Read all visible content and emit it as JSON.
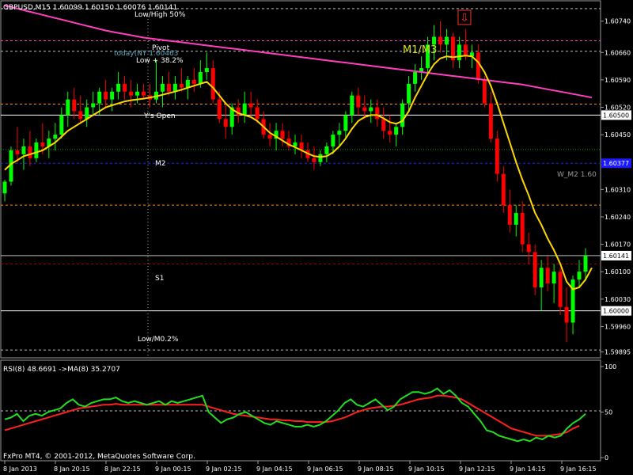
{
  "header": {
    "symbol_info": "GBPUSD,M15  1.60099 1.60150 1.60076 1.60141",
    "down_arrow_icon": "down-arrow-icon"
  },
  "annotations": {
    "lowhigh50": "Low/High 50%",
    "pivot": "Pivot",
    "today": "today(NY 1.60463",
    "low382": "Low + 38.2%",
    "m1m3": "M1/M3",
    "ys_open": "Y's Open",
    "m2": "M2",
    "wm2": "W_M2 1.60",
    "s1": "S1",
    "lowm0": "Low/M0.2%"
  },
  "price_axis": {
    "ticks": [
      "1.60740",
      "1.60660",
      "1.60590",
      "1.60520",
      "1.60450",
      "1.60310",
      "1.60240",
      "1.60170",
      "1.60100",
      "1.60030",
      "1.59960",
      "1.59895"
    ],
    "boxes": [
      "1.60500",
      "1.60377",
      "1.60141",
      "1.60000"
    ]
  },
  "time_axis": {
    "labels": [
      "8 Jan 2013",
      "8 Jan 20:15",
      "8 Jan 22:15",
      "9 Jan 00:15",
      "9 Jan 02:15",
      "9 Jan 04:15",
      "9 Jan 06:15",
      "9 Jan 08:15",
      "9 Jan 10:15",
      "9 Jan 12:15",
      "9 Jan 14:15",
      "9 Jan 16:15"
    ]
  },
  "rsi_panel": {
    "label": "RSI(8) 48.6691  ->MA(8) 35.2707",
    "ticks": [
      "100",
      "50",
      "0"
    ],
    "copyright": "FxPro MT4, © 2001-2012, MetaQuotes Software Corp."
  },
  "colors": {
    "bull": "#00ff00",
    "bear": "#ff0000",
    "ma": "#ffd700",
    "ma_long": "#ff3fbf",
    "rsi": "#22dd22",
    "rsi_ma": "#ff2020"
  },
  "chart_data": {
    "type": "line",
    "title": "GBPUSD,M15",
    "ylim": [
      1.5988,
      1.6079
    ],
    "candles": [
      [
        1.603,
        1.60335,
        1.6028,
        1.6033
      ],
      [
        1.6033,
        1.6042,
        1.6032,
        1.6041
      ],
      [
        1.6041,
        1.6047,
        1.6038,
        1.604
      ],
      [
        1.604,
        1.6044,
        1.6036,
        1.6042
      ],
      [
        1.6042,
        1.6046,
        1.6037,
        1.6039
      ],
      [
        1.6039,
        1.6044,
        1.6038,
        1.6043
      ],
      [
        1.6043,
        1.6048,
        1.604,
        1.6042
      ],
      [
        1.6042,
        1.6046,
        1.6039,
        1.6044
      ],
      [
        1.6044,
        1.6048,
        1.6041,
        1.6045
      ],
      [
        1.6045,
        1.6052,
        1.6044,
        1.605
      ],
      [
        1.605,
        1.6056,
        1.6047,
        1.6054
      ],
      [
        1.6054,
        1.6057,
        1.6049,
        1.6051
      ],
      [
        1.6051,
        1.6055,
        1.6048,
        1.6049
      ],
      [
        1.6049,
        1.6054,
        1.6047,
        1.6052
      ],
      [
        1.6052,
        1.6056,
        1.605,
        1.6053
      ],
      [
        1.6053,
        1.6057,
        1.605,
        1.6056
      ],
      [
        1.6056,
        1.6059,
        1.6052,
        1.6054
      ],
      [
        1.6054,
        1.6057,
        1.6051,
        1.6056
      ],
      [
        1.6056,
        1.6061,
        1.6054,
        1.6058
      ],
      [
        1.6058,
        1.606,
        1.6054,
        1.6056
      ],
      [
        1.6056,
        1.6059,
        1.6052,
        1.6055
      ],
      [
        1.6055,
        1.6058,
        1.6053,
        1.6056
      ],
      [
        1.6056,
        1.6058,
        1.6054,
        1.6055
      ],
      [
        1.6055,
        1.6058,
        1.6052,
        1.6054
      ],
      [
        1.6054,
        1.6064,
        1.6053,
        1.6056
      ],
      [
        1.6056,
        1.606,
        1.6052,
        1.6058
      ],
      [
        1.6058,
        1.6061,
        1.6055,
        1.6056
      ],
      [
        1.6056,
        1.606,
        1.6054,
        1.6058
      ],
      [
        1.6058,
        1.6062,
        1.6056,
        1.6057
      ],
      [
        1.6057,
        1.606,
        1.6054,
        1.6059
      ],
      [
        1.6059,
        1.6062,
        1.6056,
        1.6058
      ],
      [
        1.6058,
        1.6064,
        1.6057,
        1.6061
      ],
      [
        1.6061,
        1.6066,
        1.6059,
        1.6062
      ],
      [
        1.6062,
        1.6064,
        1.6053,
        1.6054
      ],
      [
        1.6054,
        1.6056,
        1.6048,
        1.6049
      ],
      [
        1.6049,
        1.6053,
        1.6044,
        1.6047
      ],
      [
        1.6047,
        1.6053,
        1.6045,
        1.6052
      ],
      [
        1.6052,
        1.6054,
        1.6048,
        1.605
      ],
      [
        1.605,
        1.6056,
        1.6048,
        1.6053
      ],
      [
        1.6053,
        1.6056,
        1.605,
        1.6052
      ],
      [
        1.6052,
        1.6054,
        1.6048,
        1.6049
      ],
      [
        1.6049,
        1.6051,
        1.6044,
        1.6045
      ],
      [
        1.6045,
        1.6048,
        1.6042,
        1.6044
      ],
      [
        1.6044,
        1.6048,
        1.6041,
        1.6046
      ],
      [
        1.6046,
        1.6048,
        1.6042,
        1.6044
      ],
      [
        1.6044,
        1.6046,
        1.6041,
        1.6042
      ],
      [
        1.6042,
        1.6045,
        1.604,
        1.6043
      ],
      [
        1.6043,
        1.6045,
        1.6039,
        1.6041
      ],
      [
        1.6041,
        1.6043,
        1.6038,
        1.6039
      ],
      [
        1.6039,
        1.6042,
        1.6036,
        1.6038
      ],
      [
        1.6038,
        1.6041,
        1.6037,
        1.604
      ],
      [
        1.604,
        1.6043,
        1.6038,
        1.6042
      ],
      [
        1.6042,
        1.6046,
        1.604,
        1.6045
      ],
      [
        1.6045,
        1.6048,
        1.6042,
        1.6046
      ],
      [
        1.6046,
        1.6051,
        1.6044,
        1.605
      ],
      [
        1.605,
        1.6056,
        1.6048,
        1.6055
      ],
      [
        1.6055,
        1.6057,
        1.605,
        1.6052
      ],
      [
        1.6052,
        1.6055,
        1.6049,
        1.6051
      ],
      [
        1.6051,
        1.6054,
        1.6048,
        1.6052
      ],
      [
        1.6052,
        1.6054,
        1.6047,
        1.6049
      ],
      [
        1.6049,
        1.6052,
        1.6044,
        1.6046
      ],
      [
        1.6046,
        1.605,
        1.6043,
        1.6045
      ],
      [
        1.6045,
        1.6048,
        1.6042,
        1.6047
      ],
      [
        1.6047,
        1.6054,
        1.6045,
        1.6053
      ],
      [
        1.6053,
        1.606,
        1.6051,
        1.6058
      ],
      [
        1.6058,
        1.6063,
        1.6056,
        1.6061
      ],
      [
        1.6061,
        1.6065,
        1.6059,
        1.6062
      ],
      [
        1.6062,
        1.607,
        1.606,
        1.6068
      ],
      [
        1.6068,
        1.6073,
        1.6064,
        1.607
      ],
      [
        1.607,
        1.6074,
        1.6066,
        1.6068
      ],
      [
        1.6068,
        1.6072,
        1.6064,
        1.607
      ],
      [
        1.607,
        1.6071,
        1.6062,
        1.6064
      ],
      [
        1.6064,
        1.607,
        1.6062,
        1.6068
      ],
      [
        1.6068,
        1.6072,
        1.6064,
        1.6065
      ],
      [
        1.6065,
        1.6068,
        1.6062,
        1.6066
      ],
      [
        1.6066,
        1.6068,
        1.6058,
        1.6059
      ],
      [
        1.6059,
        1.606,
        1.6052,
        1.6053
      ],
      [
        1.6053,
        1.6056,
        1.6043,
        1.6044
      ],
      [
        1.6044,
        1.6046,
        1.6033,
        1.6035
      ],
      [
        1.6035,
        1.6037,
        1.6025,
        1.6027
      ],
      [
        1.6027,
        1.6031,
        1.602,
        1.6022
      ],
      [
        1.6022,
        1.6027,
        1.6019,
        1.6025
      ],
      [
        1.6025,
        1.6028,
        1.6015,
        1.6017
      ],
      [
        1.6017,
        1.602,
        1.6012,
        1.6015
      ],
      [
        1.6015,
        1.6017,
        1.6004,
        1.6006
      ],
      [
        1.6006,
        1.6013,
        1.6,
        1.6011
      ],
      [
        1.6011,
        1.6014,
        1.6005,
        1.6007
      ],
      [
        1.6007,
        1.6012,
        1.6002,
        1.601
      ],
      [
        1.601,
        1.6011,
        1.5999,
        1.6001
      ],
      [
        1.6001,
        1.6006,
        1.5992,
        1.5997
      ],
      [
        1.5997,
        1.6009,
        1.5994,
        1.6008
      ],
      [
        1.6008,
        1.6013,
        1.6006,
        1.601
      ],
      [
        1.601,
        1.6016,
        1.60076,
        1.60141
      ]
    ],
    "ma_short": [
      1.6036,
      1.60375,
      1.60385,
      1.60395,
      1.604,
      1.60405,
      1.6041,
      1.6042,
      1.6043,
      1.60445,
      1.6046,
      1.6047,
      1.6048,
      1.6049,
      1.605,
      1.6051,
      1.6052,
      1.60525,
      1.6053,
      1.60535,
      1.60538,
      1.6054,
      1.60542,
      1.60545,
      1.60548,
      1.60552,
      1.60556,
      1.6056,
      1.60565,
      1.6057,
      1.60575,
      1.6058,
      1.60585,
      1.6057,
      1.6055,
      1.6053,
      1.60515,
      1.60505,
      1.605,
      1.60495,
      1.60485,
      1.6047,
      1.60455,
      1.60445,
      1.60435,
      1.60425,
      1.60418,
      1.6041,
      1.60402,
      1.60395,
      1.60393,
      1.60395,
      1.60405,
      1.6042,
      1.6044,
      1.60465,
      1.60485,
      1.60495,
      1.605,
      1.605,
      1.60492,
      1.60482,
      1.60478,
      1.60485,
      1.6051,
      1.60545,
      1.60575,
      1.60605,
      1.6063,
      1.60645,
      1.6065,
      1.60648,
      1.6065,
      1.60652,
      1.6065,
      1.60635,
      1.6061,
      1.60575,
      1.6053,
      1.6048,
      1.6043,
      1.6038,
      1.60335,
      1.60295,
      1.6025,
      1.6022,
      1.60185,
      1.60155,
      1.6012,
      1.60075,
      1.60055,
      1.6006,
      1.6008,
      1.6011
    ],
    "ma_long": [
      1.6078,
      1.60776,
      1.60772,
      1.60768,
      1.60764,
      1.6076,
      1.60756,
      1.60752,
      1.60748,
      1.60744,
      1.6074,
      1.60736,
      1.60732,
      1.60728,
      1.60724,
      1.6072,
      1.60716,
      1.60713,
      1.6071,
      1.60707,
      1.60704,
      1.60701,
      1.60698,
      1.60696,
      1.60694,
      1.60692,
      1.6069,
      1.60688,
      1.60686,
      1.60684,
      1.60682,
      1.6068,
      1.60678,
      1.60676,
      1.60674,
      1.60672,
      1.6067,
      1.60668,
      1.60666,
      1.60664,
      1.60662,
      1.6066,
      1.60658,
      1.60656,
      1.60654,
      1.60652,
      1.6065,
      1.60648,
      1.60646,
      1.60644,
      1.60642,
      1.6064,
      1.60638,
      1.60636,
      1.60634,
      1.60632,
      1.6063,
      1.60628,
      1.60626,
      1.60624,
      1.60622,
      1.6062,
      1.60618,
      1.60616,
      1.60614,
      1.60612,
      1.6061,
      1.60608,
      1.60606,
      1.60604,
      1.60602,
      1.606,
      1.60598,
      1.60596,
      1.60594,
      1.60592,
      1.6059,
      1.60588,
      1.60586,
      1.60584,
      1.60582,
      1.6058,
      1.60578,
      1.60575,
      1.60572,
      1.60569,
      1.60566,
      1.60563,
      1.6056,
      1.60557,
      1.60554,
      1.60551,
      1.60548,
      1.60545
    ],
    "levels": [
      {
        "name": "lowhigh50",
        "value": 1.60772,
        "color": "#bbbbbb",
        "style": "dash"
      },
      {
        "name": "pivot",
        "value": 1.6069,
        "color": "#ff3fbf",
        "style": "dash"
      },
      {
        "name": "low382",
        "value": 1.60663,
        "color": "#bbbbbb",
        "style": "dash"
      },
      {
        "name": "orange1",
        "value": 1.60528,
        "color": "#ff8c00",
        "style": "dash"
      },
      {
        "name": "ys_open",
        "value": 1.605,
        "color": "#ffffff",
        "style": "solid"
      },
      {
        "name": "m2",
        "value": 1.60412,
        "color": "#00aa00",
        "style": "dot"
      },
      {
        "name": "wm2",
        "value": 1.60377,
        "color": "#2020ff",
        "style": "dash"
      },
      {
        "name": "orange2",
        "value": 1.6027,
        "color": "#ff8c00",
        "style": "dash"
      },
      {
        "name": "line2",
        "value": 1.60141,
        "color": "#bbbbbb",
        "style": "solid"
      },
      {
        "name": "s1",
        "value": 1.6012,
        "color": "#aa0000",
        "style": "dash"
      },
      {
        "name": "ninety",
        "value": 1.6,
        "color": "#ffffff",
        "style": "solid"
      },
      {
        "name": "lowm0",
        "value": 1.599,
        "color": "#bbbbbb",
        "style": "dash"
      }
    ],
    "rsi": [
      42,
      44,
      48,
      40,
      46,
      48,
      46,
      50,
      52,
      54,
      60,
      64,
      58,
      56,
      60,
      62,
      64,
      64,
      66,
      62,
      60,
      62,
      60,
      58,
      60,
      62,
      58,
      62,
      60,
      62,
      64,
      66,
      68,
      50,
      44,
      38,
      42,
      44,
      48,
      50,
      46,
      42,
      38,
      36,
      40,
      38,
      36,
      34,
      34,
      36,
      34,
      36,
      40,
      46,
      52,
      60,
      64,
      58,
      56,
      60,
      64,
      58,
      52,
      56,
      64,
      68,
      72,
      72,
      70,
      72,
      76,
      70,
      74,
      68,
      60,
      56,
      48,
      40,
      30,
      28,
      24,
      22,
      20,
      18,
      20,
      18,
      22,
      20,
      24,
      22,
      24,
      32,
      38,
      42,
      48
    ],
    "rsi_ma": [
      30,
      32,
      34,
      36,
      38,
      40,
      42,
      44,
      46,
      48,
      50,
      52,
      54,
      55,
      56,
      57,
      58,
      58,
      59,
      58,
      58,
      58,
      58,
      58,
      58,
      58,
      58,
      58,
      58,
      58,
      58,
      58,
      58,
      56,
      54,
      52,
      50,
      48,
      47,
      46,
      45,
      44,
      43,
      42,
      42,
      41,
      41,
      40,
      40,
      39,
      39,
      39,
      39,
      40,
      42,
      44,
      47,
      50,
      52,
      54,
      55,
      56,
      56,
      57,
      58,
      60,
      62,
      64,
      65,
      66,
      68,
      68,
      67,
      66,
      64,
      60,
      56,
      52,
      48,
      44,
      40,
      36,
      32,
      30,
      28,
      26,
      24,
      24,
      24,
      25,
      26,
      28,
      32,
      35
    ]
  }
}
